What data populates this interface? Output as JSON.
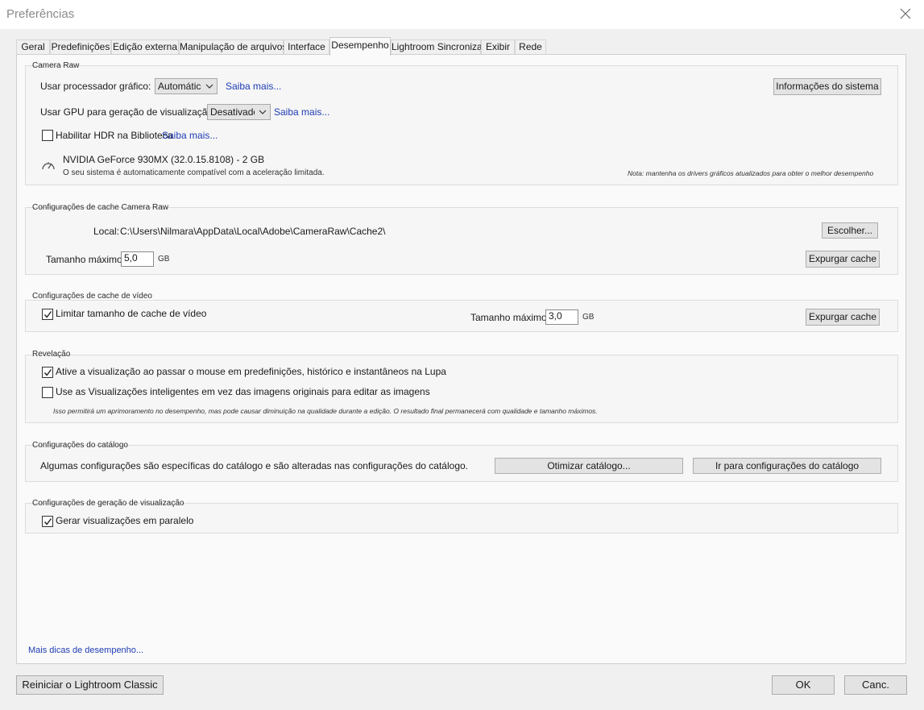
{
  "window": {
    "title": "Preferências",
    "close_icon": "close-icon"
  },
  "tabs": [
    {
      "label": "Geral",
      "active": false
    },
    {
      "label": "Predefinições",
      "active": false
    },
    {
      "label": "Edição externa",
      "active": false
    },
    {
      "label": "Manipulação de arquivos",
      "active": false
    },
    {
      "label": "Interface",
      "active": false
    },
    {
      "label": "Desempenho",
      "active": true
    },
    {
      "label": "Lightroom Sincronizar",
      "active": false
    },
    {
      "label": "Exibir",
      "active": false
    },
    {
      "label": "Rede",
      "active": false
    }
  ],
  "camera_raw": {
    "group_label": "Camera Raw",
    "gpu_label": "Usar processador gráfico:",
    "gpu_value": "Automático",
    "gpu_learn_more": "Saiba mais...",
    "system_info_button": "Informações do sistema",
    "gpu_preview_label": "Usar GPU para geração de visualização :",
    "gpu_preview_value": "Desativado",
    "gpu_preview_learn_more": "Saiba mais...",
    "hdr_checkbox_label": "Habilitar HDR na Biblioteca",
    "hdr_checked": false,
    "hdr_learn_more": "Saiba mais...",
    "gpu_name": "NVIDIA GeForce 930MX (32.0.15.8108) - 2 GB",
    "gpu_status": "O seu sistema é automaticamente compatível com a aceleração limitada.",
    "gpu_icon": "speedometer-icon",
    "driver_note": "Nota: mantenha os drivers gráficos atualizados para obter o melhor desempenho"
  },
  "camera_raw_cache": {
    "group_label": "Configurações de cache Camera Raw",
    "location_label": "Local:",
    "location_value": "C:\\Users\\Nilmara\\AppData\\Local\\Adobe\\CameraRaw\\Cache2\\",
    "choose_button": "Escolher...",
    "max_size_label": "Tamanho máximo:",
    "max_size_value": "5,0",
    "max_size_unit": "GB",
    "purge_button": "Expurgar cache"
  },
  "video_cache": {
    "group_label": "Configurações de cache de vídeo",
    "limit_checkbox_label": "Limitar tamanho de cache de vídeo",
    "limit_checked": true,
    "max_size_label": "Tamanho máximo:",
    "max_size_value": "3,0",
    "max_size_unit": "GB",
    "purge_button": "Expurgar cache"
  },
  "develop": {
    "group_label": "Revelação",
    "hover_preview_label": "Ative a visualização ao passar o mouse em predefinições, histórico e instantâneos na Lupa",
    "hover_preview_checked": true,
    "smart_previews_label": "Use as Visualizações inteligentes em vez das imagens originais para editar as imagens",
    "smart_previews_checked": false,
    "smart_previews_note": "Isso permitirá um aprimoramento no desempenho, mas pode causar diminuição na qualidade durante a edição. O resultado final permanecerá com qualidade e tamanho máximos."
  },
  "catalog": {
    "group_label": "Configurações do catálogo",
    "description": "Algumas configurações são específicas do catálogo e são alteradas nas configurações do catálogo.",
    "optimize_button": "Otimizar catálogo...",
    "go_to_settings_button": "Ir para configurações do catálogo"
  },
  "preview_generation": {
    "group_label": "Configurações de geração de visualização",
    "parallel_label": "Gerar visualizações em paralelo",
    "parallel_checked": true
  },
  "more_tips_link": "Mais dicas de desempenho...",
  "footer": {
    "restart_button": "Reiniciar o Lightroom Classic",
    "ok_button": "OK",
    "cancel_button": "Canc."
  }
}
